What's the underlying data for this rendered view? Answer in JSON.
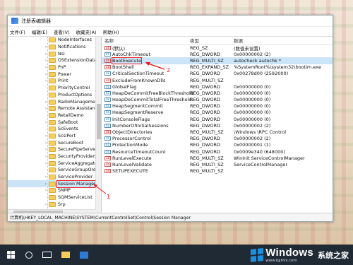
{
  "window": {
    "title": "注册表编辑器"
  },
  "menu": [
    "文件(F)",
    "编辑(E)",
    "查看(V)",
    "收藏夹(A)",
    "帮助(H)"
  ],
  "tree": [
    {
      "label": "NodeInterfaces",
      "expander": ""
    },
    {
      "label": "Notifications",
      "expander": "›"
    },
    {
      "label": "Nsi",
      "expander": "›"
    },
    {
      "label": "OSExtensionDatab",
      "expander": "›"
    },
    {
      "label": "PnP",
      "expander": "›"
    },
    {
      "label": "Power",
      "expander": "›"
    },
    {
      "label": "Print",
      "expander": "›"
    },
    {
      "label": "PriorityControl",
      "expander": ""
    },
    {
      "label": "ProductOptions",
      "expander": ""
    },
    {
      "label": "RadioManagement",
      "expander": "›"
    },
    {
      "label": "Remote Assistance",
      "expander": "›"
    },
    {
      "label": "RetailDemo",
      "expander": ""
    },
    {
      "label": "SafeBoot",
      "expander": "›"
    },
    {
      "label": "ScEvents",
      "expander": ""
    },
    {
      "label": "ScsiPort",
      "expander": "›"
    },
    {
      "label": "SecureBoot",
      "expander": "›"
    },
    {
      "label": "SecurePipeServers",
      "expander": "›"
    },
    {
      "label": "SecurityProviders",
      "expander": "›"
    },
    {
      "label": "ServiceAggregated",
      "expander": "›"
    },
    {
      "label": "ServiceGroupOrde",
      "expander": ""
    },
    {
      "label": "ServiceProvider",
      "expander": "›"
    },
    {
      "label": "Session Manager",
      "expander": "›"
    },
    {
      "label": "SNMP",
      "expander": "›"
    },
    {
      "label": "SQMServiceList",
      "expander": ""
    },
    {
      "label": "Srp",
      "expander": "›"
    }
  ],
  "columns": {
    "name": "名称",
    "type": "类型",
    "data": "数据"
  },
  "values": [
    {
      "name": "(默认)",
      "type": "REG_SZ",
      "data": "(数值未设置)",
      "icon": "ab",
      "kind": "sz"
    },
    {
      "name": "AutoChkTimeout",
      "type": "REG_DWORD",
      "data": "0x00000002 (2)",
      "icon": "01",
      "kind": "bin"
    },
    {
      "name": "BootExecute",
      "type": "REG_MULTI_SZ",
      "data": "autocheck autochk *",
      "icon": "ab",
      "kind": "sz"
    },
    {
      "name": "BootShell",
      "type": "REG_EXPAND_SZ",
      "data": "%SystemRoot%\\system32\\bootim.exe",
      "icon": "ab",
      "kind": "sz"
    },
    {
      "name": "CriticalSectionTimeout",
      "type": "REG_DWORD",
      "data": "0x00278d00 (2592000)",
      "icon": "01",
      "kind": "bin"
    },
    {
      "name": "ExcludeFromKnownDlls",
      "type": "REG_MULTI_SZ",
      "data": "",
      "icon": "ab",
      "kind": "sz"
    },
    {
      "name": "GlobalFlag",
      "type": "REG_DWORD",
      "data": "0x00000000 (0)",
      "icon": "01",
      "kind": "bin"
    },
    {
      "name": "HeapDeCommitFreeBlockThreshold",
      "type": "REG_DWORD",
      "data": "0x00000000 (0)",
      "icon": "01",
      "kind": "bin"
    },
    {
      "name": "HeapDeCommitTotalFreeThreshold",
      "type": "REG_DWORD",
      "data": "0x00000000 (0)",
      "icon": "01",
      "kind": "bin"
    },
    {
      "name": "HeapSegmentCommit",
      "type": "REG_DWORD",
      "data": "0x00000000 (0)",
      "icon": "01",
      "kind": "bin"
    },
    {
      "name": "HeapSegmentReserve",
      "type": "REG_DWORD",
      "data": "0x00000000 (0)",
      "icon": "01",
      "kind": "bin"
    },
    {
      "name": "InitConsoleFlags",
      "type": "REG_DWORD",
      "data": "0x00000000 (0)",
      "icon": "01",
      "kind": "bin"
    },
    {
      "name": "NumberOfInitialSessions",
      "type": "REG_DWORD",
      "data": "0x00000002 (2)",
      "icon": "01",
      "kind": "bin"
    },
    {
      "name": "ObjectDirectories",
      "type": "REG_MULTI_SZ",
      "data": "\\Windows \\RPC Control",
      "icon": "ab",
      "kind": "sz"
    },
    {
      "name": "ProcessorControl",
      "type": "REG_DWORD",
      "data": "0x00000002 (2)",
      "icon": "01",
      "kind": "bin"
    },
    {
      "name": "ProtectionMode",
      "type": "REG_DWORD",
      "data": "0x00000001 (1)",
      "icon": "01",
      "kind": "bin"
    },
    {
      "name": "ResourceTimeoutCount",
      "type": "REG_DWORD",
      "data": "0x0009e340 (648000)",
      "icon": "01",
      "kind": "bin"
    },
    {
      "name": "RunLevelExecute",
      "type": "REG_MULTI_SZ",
      "data": "WinInit ServiceControlManager",
      "icon": "ab",
      "kind": "sz"
    },
    {
      "name": "RunLevelValidate",
      "type": "REG_MULTI_SZ",
      "data": "ServiceControlManager",
      "icon": "ab",
      "kind": "sz"
    },
    {
      "name": "SETUPEXECUTE",
      "type": "REG_MULTI_SZ",
      "data": "",
      "icon": "ab",
      "kind": "sz"
    }
  ],
  "status": "计算机\\HKEY_LOCAL_MACHINE\\SYSTEM\\CurrentControlSet\\Control\\Session Manager",
  "annotations": {
    "one": "1",
    "two": "2"
  },
  "logo": {
    "main": "Windows",
    "cn": "系统之家",
    "url": "www.bjjmlv.com"
  }
}
